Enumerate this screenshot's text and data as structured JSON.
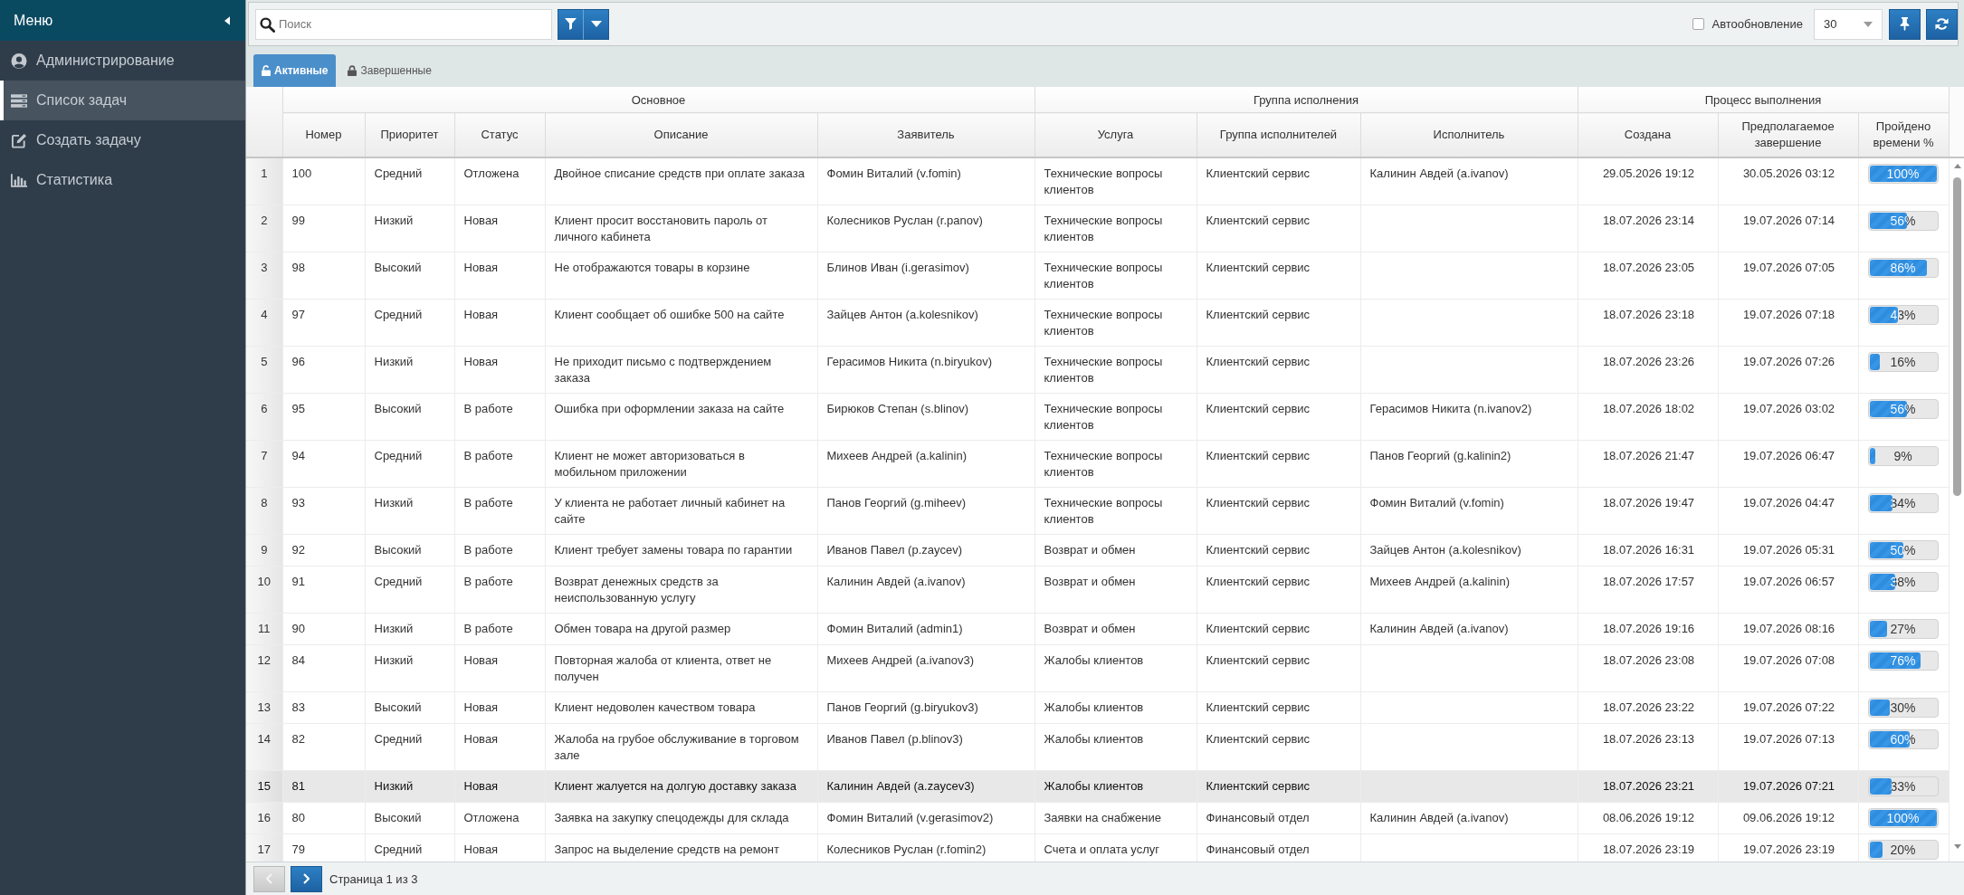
{
  "sidebar": {
    "title": "Меню",
    "items": [
      {
        "label": "Администрирование",
        "selected": false
      },
      {
        "label": "Список задач",
        "selected": true
      },
      {
        "label": "Создать задачу",
        "selected": false
      },
      {
        "label": "Статистика",
        "selected": false
      }
    ]
  },
  "toolbar": {
    "search": {
      "placeholder": "Поиск"
    },
    "auto_refresh": {
      "label": "Автообновление",
      "checked": false
    },
    "page_size": {
      "value": "30"
    }
  },
  "tabs": [
    {
      "label": "Активные",
      "selected": true
    },
    {
      "label": "Завершенные",
      "selected": false
    }
  ],
  "table": {
    "column_groups": [
      {
        "label": "Основное",
        "columns": [
          "Номер",
          "Приоритет",
          "Статус",
          "Описание",
          "Заявитель"
        ]
      },
      {
        "label": "Группа исполнения",
        "columns": [
          "Услуга",
          "Группа исполнителей",
          "Исполнитель"
        ]
      },
      {
        "label": "Процесс выполнения",
        "columns": [
          "Создана",
          "Предполагаемое завершение",
          "Пройдено времени %"
        ]
      }
    ],
    "rows": [
      {
        "row_number": "1",
        "number": "100",
        "priority": "Средний",
        "status": "Отложена",
        "description": "Двойное списание средств при оплате заказа",
        "requester": "Фомин Виталий (v.fomin)",
        "service": "Технические вопросы клиентов",
        "group": "Клиентский сервис",
        "assignee": "Калинин Авдей (a.ivanov)",
        "created": "29.05.2026 19:12",
        "due": "30.05.2026 03:12",
        "elapsed": {
          "level": 1.0,
          "reading": "100%"
        },
        "selected": false
      },
      {
        "row_number": "2",
        "number": "99",
        "priority": "Низкий",
        "status": "Новая",
        "description": "Клиент просит восстановить пароль от личного кабинета",
        "requester": "Колесников Руслан (r.panov)",
        "service": "Технические вопросы клиентов",
        "group": "Клиентский сервис",
        "created": "18.07.2026 23:14",
        "due": "19.07.2026 07:14",
        "elapsed": {
          "level": 0.56,
          "reading": "56%"
        },
        "selected": false
      },
      {
        "row_number": "3",
        "number": "98",
        "priority": "Высокий",
        "status": "Новая",
        "description": "Не отображаются товары в корзине",
        "requester": "Блинов Иван (i.gerasimov)",
        "service": "Технические вопросы клиентов",
        "group": "Клиентский сервис",
        "created": "18.07.2026 23:05",
        "due": "19.07.2026 07:05",
        "elapsed": {
          "level": 0.86,
          "reading": "86%"
        },
        "selected": false
      },
      {
        "row_number": "4",
        "number": "97",
        "priority": "Средний",
        "status": "Новая",
        "description": "Клиент сообщает об ошибке 500 на сайте",
        "requester": "Зайцев Антон (a.kolesnikov)",
        "service": "Технические вопросы клиентов",
        "group": "Клиентский сервис",
        "created": "18.07.2026 23:18",
        "due": "19.07.2026 07:18",
        "elapsed": {
          "level": 0.43,
          "reading": "43%"
        },
        "selected": false
      },
      {
        "row_number": "5",
        "number": "96",
        "priority": "Низкий",
        "status": "Новая",
        "description": "Не приходит письмо с подтверждением заказа",
        "requester": "Герасимов Никита (n.biryukov)",
        "service": "Технические вопросы клиентов",
        "group": "Клиентский сервис",
        "created": "18.07.2026 23:26",
        "due": "19.07.2026 07:26",
        "elapsed": {
          "level": 0.16,
          "reading": "16%"
        },
        "selected": false
      },
      {
        "row_number": "6",
        "number": "95",
        "priority": "Высокий",
        "status": "В работе",
        "description": "Ошибка при оформлении заказа на сайте",
        "requester": "Бирюков Степан (s.blinov)",
        "service": "Технические вопросы клиентов",
        "group": "Клиентский сервис",
        "assignee": "Герасимов Никита (n.ivanov2)",
        "created": "18.07.2026 18:02",
        "due": "19.07.2026 03:02",
        "elapsed": {
          "level": 0.56,
          "reading": "56%"
        },
        "selected": false
      },
      {
        "row_number": "7",
        "number": "94",
        "priority": "Средний",
        "status": "В работе",
        "description": "Клиент не может авторизоваться в мобильном приложении",
        "requester": "Михеев Андрей (a.kalinin)",
        "service": "Технические вопросы клиентов",
        "group": "Клиентский сервис",
        "assignee": "Панов Георгий (g.kalinin2)",
        "created": "18.07.2026 21:47",
        "due": "19.07.2026 06:47",
        "elapsed": {
          "level": 0.09,
          "reading": "9%"
        },
        "selected": false
      },
      {
        "row_number": "8",
        "number": "93",
        "priority": "Низкий",
        "status": "В работе",
        "description": "У клиента не работает личный кабинет на сайте",
        "requester": "Панов Георгий (g.miheev)",
        "service": "Технические вопросы клиентов",
        "group": "Клиентский сервис",
        "assignee": "Фомин Виталий (v.fomin)",
        "created": "18.07.2026 19:47",
        "due": "19.07.2026 04:47",
        "elapsed": {
          "level": 0.34,
          "reading": "34%"
        },
        "selected": false
      },
      {
        "row_number": "9",
        "number": "92",
        "priority": "Высокий",
        "status": "В работе",
        "description": "Клиент требует замены товара по гарантии",
        "requester": "Иванов Павел (p.zaycev)",
        "service": "Возврат и обмен",
        "group": "Клиентский сервис",
        "assignee": "Зайцев Антон (a.kolesnikov)",
        "created": "18.07.2026 16:31",
        "due": "19.07.2026 05:31",
        "elapsed": {
          "level": 0.5,
          "reading": "50%"
        },
        "selected": false
      },
      {
        "row_number": "10",
        "number": "91",
        "priority": "Средний",
        "status": "В работе",
        "description": "Возврат денежных средств за неиспользованную услугу",
        "requester": "Калинин Авдей (a.ivanov)",
        "service": "Возврат и обмен",
        "group": "Клиентский сервис",
        "assignee": "Михеев Андрей (a.kalinin)",
        "created": "18.07.2026 17:57",
        "due": "19.07.2026 06:57",
        "elapsed": {
          "level": 0.38,
          "reading": "38%"
        },
        "selected": false
      },
      {
        "row_number": "11",
        "number": "90",
        "priority": "Низкий",
        "status": "В работе",
        "description": "Обмен товара на другой размер",
        "requester": "Фомин Виталий (admin1)",
        "service": "Возврат и обмен",
        "group": "Клиентский сервис",
        "assignee": "Калинин Авдей (a.ivanov)",
        "created": "18.07.2026 19:16",
        "due": "19.07.2026 08:16",
        "elapsed": {
          "level": 0.27,
          "reading": "27%"
        },
        "selected": false
      },
      {
        "row_number": "12",
        "number": "84",
        "priority": "Низкий",
        "status": "Новая",
        "description": "Повторная жалоба от клиента, ответ не получен",
        "requester": "Михеев Андрей (a.ivanov3)",
        "service": "Жалобы клиентов",
        "group": "Клиентский сервис",
        "created": "18.07.2026 23:08",
        "due": "19.07.2026 07:08",
        "elapsed": {
          "level": 0.76,
          "reading": "76%"
        },
        "selected": false
      },
      {
        "row_number": "13",
        "number": "83",
        "priority": "Высокий",
        "status": "Новая",
        "description": "Клиент недоволен качеством товара",
        "requester": "Панов Георгий (g.biryukov3)",
        "service": "Жалобы клиентов",
        "group": "Клиентский сервис",
        "created": "18.07.2026 23:22",
        "due": "19.07.2026 07:22",
        "elapsed": {
          "level": 0.3,
          "reading": "30%"
        },
        "selected": false
      },
      {
        "row_number": "14",
        "number": "82",
        "priority": "Средний",
        "status": "Новая",
        "description": "Жалоба на грубое обслуживание в торговом зале",
        "requester": "Иванов Павел (p.blinov3)",
        "service": "Жалобы клиентов",
        "group": "Клиентский сервис",
        "created": "18.07.2026 23:13",
        "due": "19.07.2026 07:13",
        "elapsed": {
          "level": 0.6,
          "reading": "60%"
        },
        "selected": false
      },
      {
        "row_number": "15",
        "number": "81",
        "priority": "Низкий",
        "status": "Новая",
        "description": "Клиент жалуется на долгую доставку заказа",
        "requester": "Калинин Авдей (a.zaycev3)",
        "service": "Жалобы клиентов",
        "group": "Клиентский сервис",
        "created": "18.07.2026 23:21",
        "due": "19.07.2026 07:21",
        "elapsed": {
          "level": 0.33,
          "reading": "33%"
        },
        "selected": true
      },
      {
        "row_number": "16",
        "number": "80",
        "priority": "Высокий",
        "status": "Отложена",
        "description": "Заявка на закупку спецодежды для склада",
        "requester": "Фомин Виталий (v.gerasimov2)",
        "service": "Заявки на снабжение",
        "group": "Финансовый отдел",
        "assignee": "Калинин Авдей (a.ivanov)",
        "created": "08.06.2026 19:12",
        "due": "09.06.2026 19:12",
        "elapsed": {
          "level": 1.0,
          "reading": "100%"
        },
        "selected": false
      },
      {
        "row_number": "17",
        "number": "79",
        "priority": "Средний",
        "status": "Новая",
        "description": "Запрос на выделение средств на ремонт",
        "requester": "Колесников Руслан (r.fomin2)",
        "service": "Счета и оплата услуг",
        "group": "Финансовый отдел",
        "created": "18.07.2026 23:19",
        "due": "19.07.2026 23:19",
        "elapsed": {
          "level": 0.2,
          "reading": "20%"
        },
        "selected": false
      }
    ]
  },
  "pager": {
    "prev": {
      "disabled": true
    },
    "next": {
      "disabled": false
    },
    "label": "Страница 1 из 3"
  }
}
